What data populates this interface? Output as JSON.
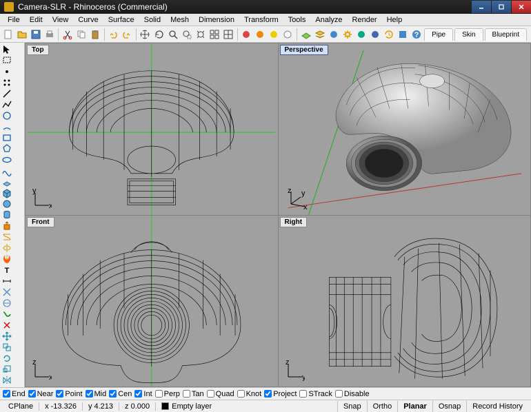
{
  "window": {
    "title": "Camera-SLR - Rhinoceros (Commercial)"
  },
  "menus": [
    "File",
    "Edit",
    "View",
    "Curve",
    "Surface",
    "Solid",
    "Mesh",
    "Dimension",
    "Transform",
    "Tools",
    "Analyze",
    "Render",
    "Help"
  ],
  "tabs": [
    "Pipe",
    "Skin",
    "Blueprint"
  ],
  "viewports": {
    "top": "Top",
    "persp": "Perspective",
    "front": "Front",
    "right": "Right"
  },
  "osnaps": [
    {
      "label": "End",
      "on": true
    },
    {
      "label": "Near",
      "on": true
    },
    {
      "label": "Point",
      "on": true
    },
    {
      "label": "Mid",
      "on": true
    },
    {
      "label": "Cen",
      "on": true
    },
    {
      "label": "Int",
      "on": true
    },
    {
      "label": "Perp",
      "on": false
    },
    {
      "label": "Tan",
      "on": false
    },
    {
      "label": "Quad",
      "on": false
    },
    {
      "label": "Knot",
      "on": false
    },
    {
      "label": "Project",
      "on": true
    },
    {
      "label": "STrack",
      "on": false
    },
    {
      "label": "Disable",
      "on": false
    }
  ],
  "status": {
    "cplane": "CPlane",
    "x": "x -13.326",
    "y": "y 4.213",
    "z": "z 0.000",
    "layer": "Empty layer",
    "panes": [
      "Snap",
      "Ortho",
      "Planar",
      "Osnap",
      "Record History"
    ],
    "active_pane_index": 2
  }
}
